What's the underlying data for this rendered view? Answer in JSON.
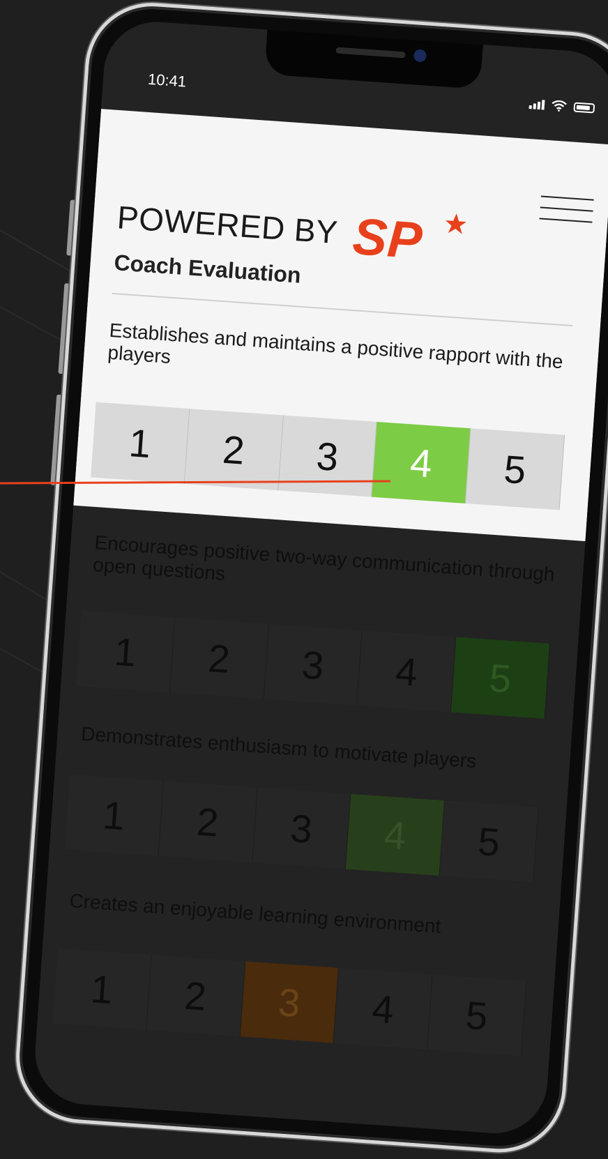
{
  "status_bar": {
    "time": "10:41"
  },
  "header": {
    "powered_by": "POWERED BY",
    "logo_text": "SP",
    "title": "Coach Evaluation"
  },
  "colors": {
    "accent_red": "#e8401c",
    "selected_green": "#7dcc45"
  },
  "questions": [
    {
      "text": "Establishes and maintains a positive rapport with the players",
      "options": [
        "1",
        "2",
        "3",
        "4",
        "5"
      ],
      "selected": "4"
    },
    {
      "text": "Encourages positive two-way communication through open questions",
      "options": [
        "1",
        "2",
        "3",
        "4",
        "5"
      ],
      "selected": "5"
    },
    {
      "text": "Demonstrates enthusiasm to motivate players",
      "options": [
        "1",
        "2",
        "3",
        "4",
        "5"
      ],
      "selected": "4"
    },
    {
      "text": "Creates an enjoyable learning environment",
      "options": [
        "1",
        "2",
        "3",
        "4",
        "5"
      ],
      "selected": "3"
    }
  ]
}
